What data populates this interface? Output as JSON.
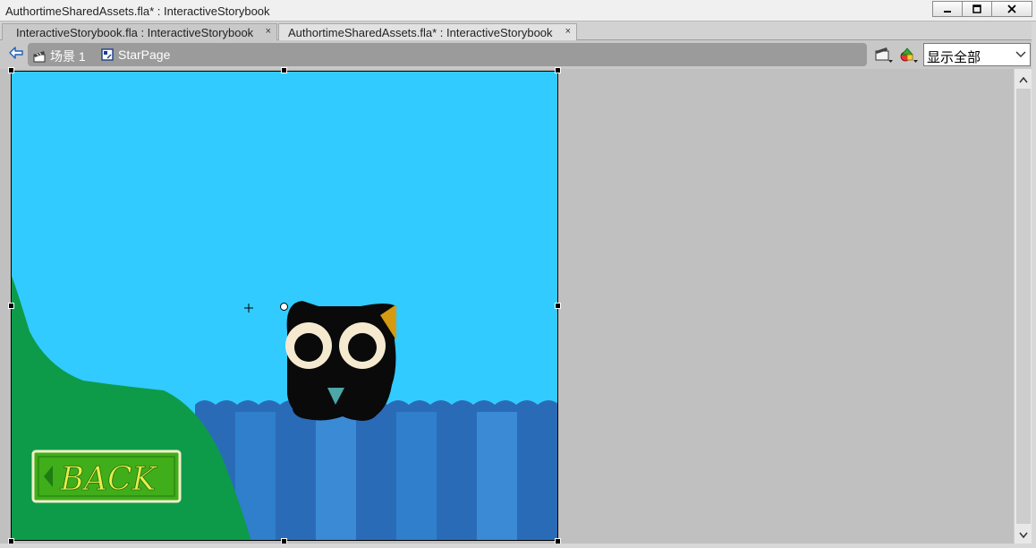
{
  "window": {
    "title": "AuthortimeSharedAssets.fla* : InteractiveStorybook",
    "buttons": {
      "minimize": "minimize-icon",
      "maximize": "maximize-icon",
      "close": "close-icon"
    }
  },
  "tabs": [
    {
      "label": "InteractiveStorybook.fla : InteractiveStorybook",
      "close": "×",
      "active": false
    },
    {
      "label": "AuthortimeSharedAssets.fla* : InteractiveStorybook",
      "close": "×",
      "active": true
    }
  ],
  "editbar": {
    "scene_label": "场景 1",
    "symbol_label": "StarPage",
    "zoom_value": "显示全部",
    "icons": {
      "back": "back-arrow-icon",
      "scene": "clapperboard-icon",
      "symbol": "movieclip-symbol-icon",
      "edit_scene": "edit-scene-icon",
      "edit_symbol": "edit-symbol-icon"
    }
  },
  "stage": {
    "button_text": "BACK",
    "colors": {
      "sky": "#32cbff",
      "hill": "#0d9b4a",
      "water_dark": "#2a6bb8",
      "water_light": "#3a8ad6",
      "button_green": "#3fae1a",
      "button_text": "#e6f04a"
    }
  }
}
